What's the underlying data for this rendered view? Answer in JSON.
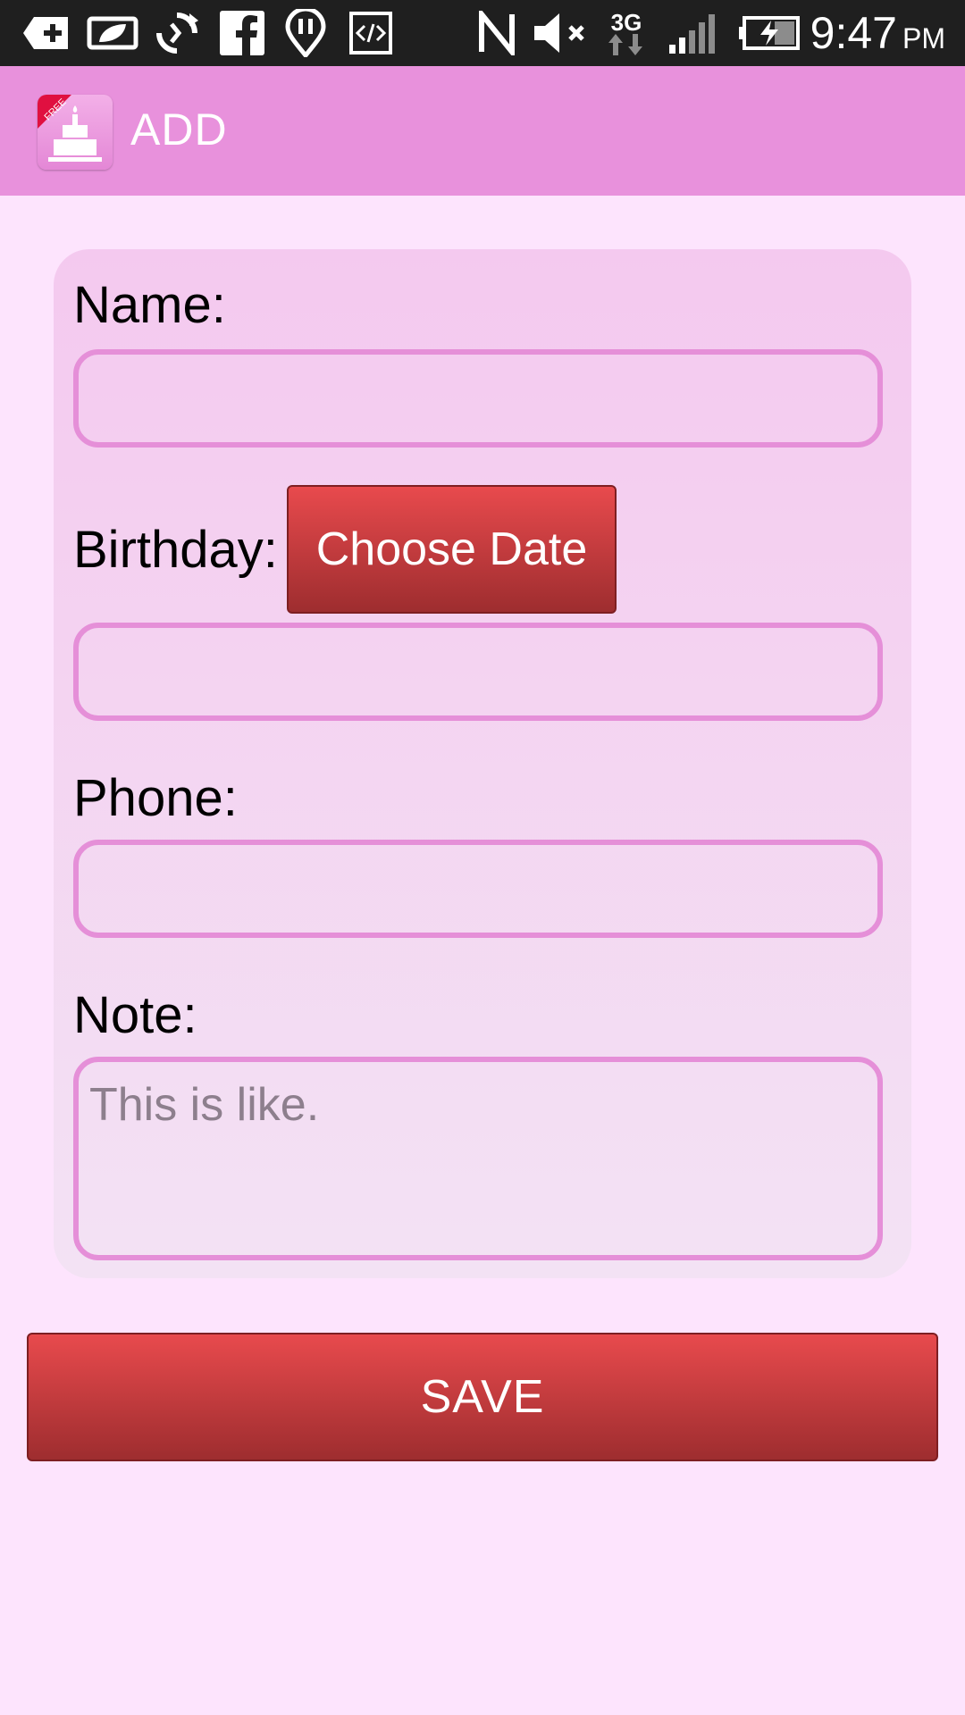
{
  "status_bar": {
    "time": "9:47",
    "ampm": "PM",
    "network": "3G"
  },
  "app_bar": {
    "logo_badge": "FREE",
    "title": "ADD"
  },
  "form": {
    "name_label": "Name:",
    "name_value": "",
    "birthday_label": "Birthday:",
    "choose_date_label": "Choose Date",
    "birthday_value": "",
    "phone_label": "Phone:",
    "phone_value": "",
    "note_label": "Note:",
    "note_placeholder": "This is like.",
    "note_value": ""
  },
  "save_label": "SAVE",
  "colors": {
    "background": "#fde4fd",
    "app_bar": "#e891dc",
    "field_border": "#e58fd8",
    "button_red": "#c83a3d"
  }
}
